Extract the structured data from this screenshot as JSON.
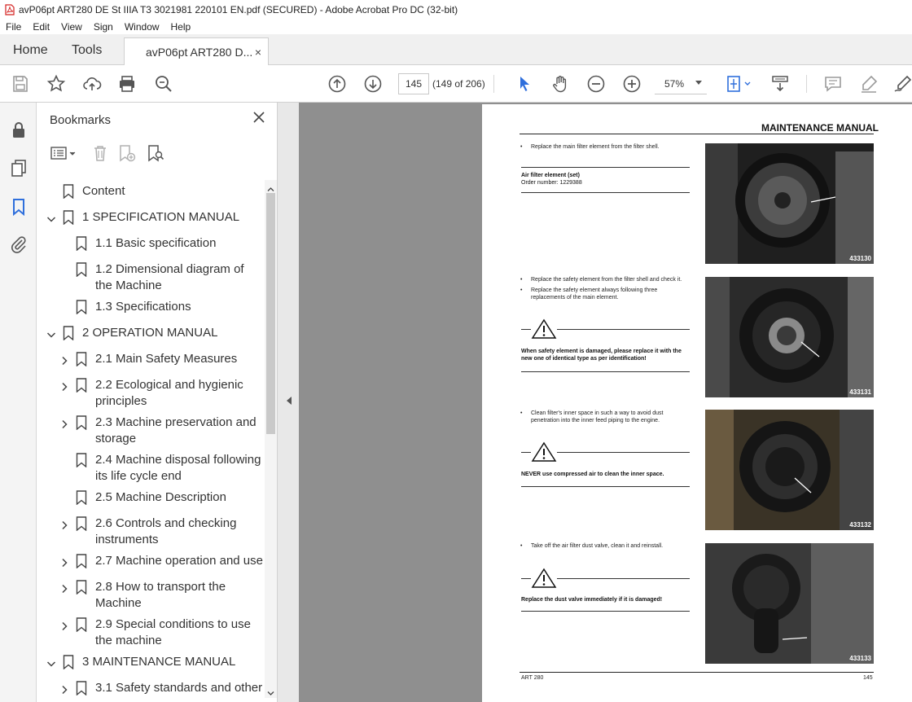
{
  "window": {
    "title": "avP06pt ART280 DE St IIIA T3 3021981 220101 EN.pdf (SECURED) - Adobe Acrobat Pro DC (32-bit)"
  },
  "menu": [
    "File",
    "Edit",
    "View",
    "Sign",
    "Window",
    "Help"
  ],
  "tabs": {
    "home": "Home",
    "tools": "Tools",
    "document": "avP06pt ART280 D...",
    "close": "×"
  },
  "toolbar": {
    "page_current": "145",
    "page_of": "(149 of 206)",
    "zoom": "57%"
  },
  "bookmarks": {
    "title": "Bookmarks",
    "items": [
      {
        "label": "Content",
        "level": 0,
        "expander": "none"
      },
      {
        "label": "1 SPECIFICATION MANUAL",
        "level": 0,
        "expander": "expanded"
      },
      {
        "label": "1.1 Basic specification",
        "level": 1,
        "expander": "none"
      },
      {
        "label": "1.2 Dimensional diagram of the Machine",
        "level": 1,
        "expander": "none"
      },
      {
        "label": "1.3 Specifications",
        "level": 1,
        "expander": "none"
      },
      {
        "label": "2 OPERATION MANUAL",
        "level": 0,
        "expander": "expanded"
      },
      {
        "label": "2.1 Main Safety Measures",
        "level": 1,
        "expander": "collapsed"
      },
      {
        "label": "2.2 Ecological and hygienic principles",
        "level": 1,
        "expander": "collapsed"
      },
      {
        "label": "2.3 Machine preservation and storage",
        "level": 1,
        "expander": "collapsed"
      },
      {
        "label": "2.4 Machine disposal following its life cycle end",
        "level": 1,
        "expander": "none"
      },
      {
        "label": "2.5 Machine Description",
        "level": 1,
        "expander": "none"
      },
      {
        "label": "2.6 Controls and checking instruments",
        "level": 1,
        "expander": "collapsed"
      },
      {
        "label": "2.7 Machine operation and use",
        "level": 1,
        "expander": "collapsed"
      },
      {
        "label": "2.8 How to transport the Machine",
        "level": 1,
        "expander": "collapsed"
      },
      {
        "label": "2.9 Special conditions to use the machine",
        "level": 1,
        "expander": "collapsed"
      },
      {
        "label": "3 MAINTENANCE MANUAL",
        "level": 0,
        "expander": "expanded"
      },
      {
        "label": "3.1 Safety standards and other",
        "level": 1,
        "expander": "collapsed"
      }
    ]
  },
  "page": {
    "header": "MAINTENANCE MANUAL",
    "sections": [
      {
        "bullets": [
          "Replace the main filter element from the filter shell."
        ],
        "part_title": "Air filter element (set)",
        "part_order": "Order number: 1229388",
        "photo_id": "433130"
      },
      {
        "bullets": [
          "Replace the safety element from the filter shell and check it.",
          "Replace the safety element always following three replacements of the main element."
        ],
        "warning": "When safety element is damaged, please replace it with the new one of identical type as per identification!",
        "photo_id": "433131"
      },
      {
        "bullets": [
          "Clean filter's inner space in such a way to avoid dust penetration into the inner feed piping to the engine."
        ],
        "warning": "NEVER use compressed air to clean the inner space.",
        "photo_id": "433132"
      },
      {
        "bullets": [
          "Take off the air filter dust valve, clean it and reinstall."
        ],
        "warning": "Replace the dust valve immediately if it is damaged!",
        "photo_id": "433133"
      }
    ],
    "footer_left": "ART 280",
    "footer_right": "145"
  },
  "colors": {
    "accent_blue": "#2f6fdc",
    "pdf_red": "#d4201f",
    "canvas_gray": "#8f8f8f"
  }
}
